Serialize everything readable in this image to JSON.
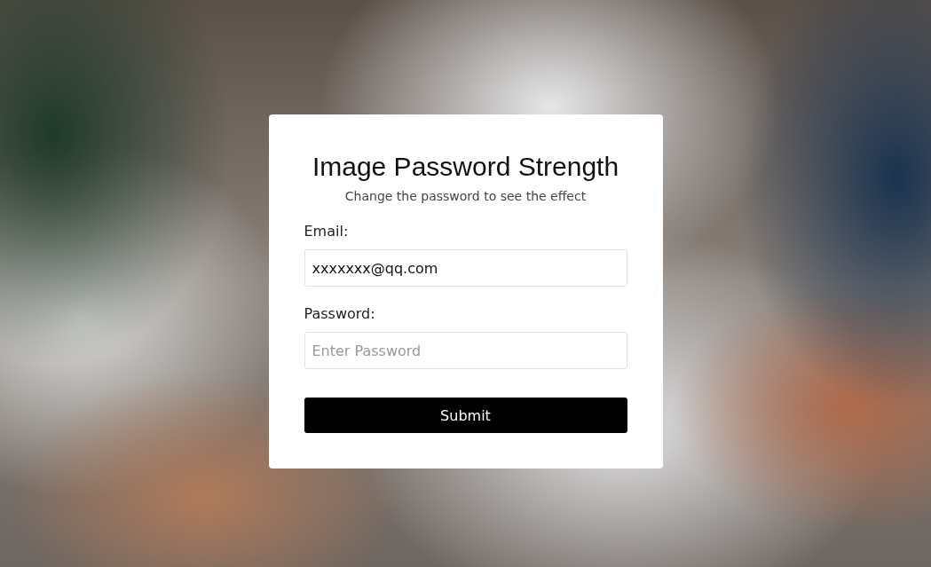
{
  "card": {
    "title": "Image Password Strength",
    "subtitle": "Change the password to see the effect"
  },
  "fields": [
    {
      "label": "Email:",
      "value": "xxxxxxx@qq.com"
    },
    {
      "label": "Password:",
      "placeholder": "Enter Password"
    }
  ],
  "submit": {
    "label": "Submit"
  }
}
